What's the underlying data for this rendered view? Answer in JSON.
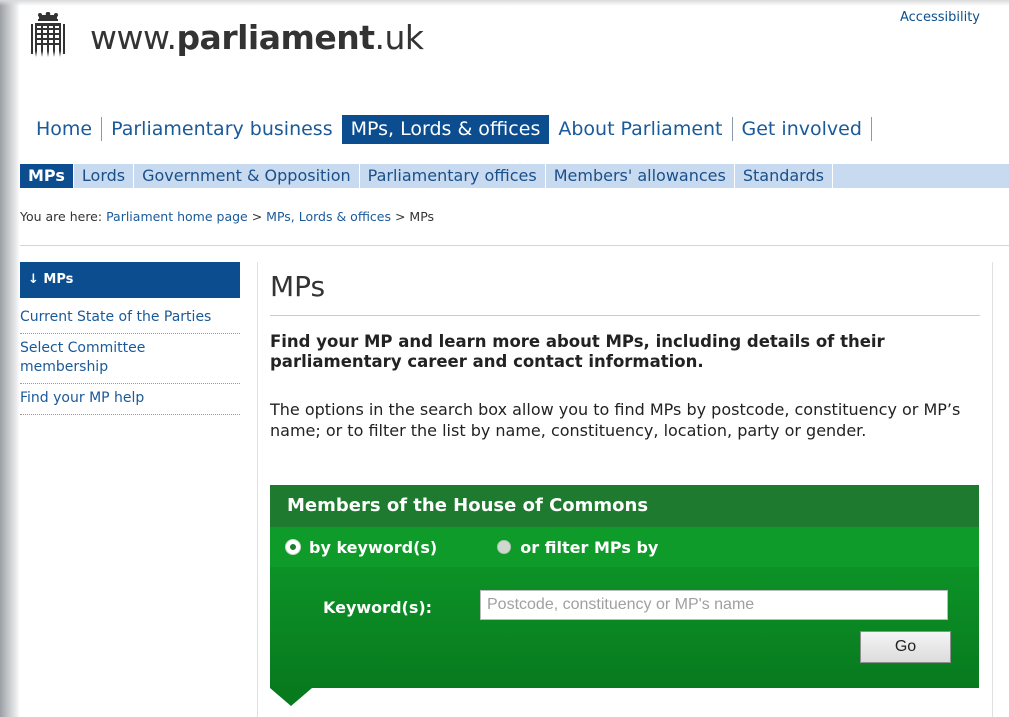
{
  "header": {
    "site_name_prefix": "www.",
    "site_name_bold": "parliament",
    "site_name_suffix": ".uk",
    "accessibility_label": "Accessibility"
  },
  "main_nav": {
    "items": [
      {
        "label": "Home"
      },
      {
        "label": "Parliamentary business"
      },
      {
        "label": "MPs, Lords & offices",
        "active": true
      },
      {
        "label": "About Parliament"
      },
      {
        "label": "Get involved"
      }
    ]
  },
  "sub_nav": {
    "items": [
      {
        "label": "MPs",
        "active": true
      },
      {
        "label": "Lords"
      },
      {
        "label": "Government & Opposition"
      },
      {
        "label": "Parliamentary offices"
      },
      {
        "label": "Members' allowances"
      },
      {
        "label": "Standards"
      }
    ]
  },
  "breadcrumb": {
    "prefix": "You are here: ",
    "items": [
      "Parliament home page",
      "MPs, Lords & offices"
    ],
    "separator": " > ",
    "current": "MPs"
  },
  "sidebar": {
    "heading": "↓ MPs",
    "items": [
      {
        "label": "Current State of the Parties"
      },
      {
        "label": "Select Committee membership"
      },
      {
        "label": "Find your MP help"
      }
    ]
  },
  "main": {
    "title": "MPs",
    "lead": "Find your MP and learn more about MPs, including details of their parliamentary career and contact information.",
    "intro": "The options in the search box allow you to find MPs by postcode, constituency or MP’s name; or to filter the list by name, constituency, location, party or gender."
  },
  "search": {
    "heading": "Members of the House of Commons",
    "option_keyword": "by keyword(s)",
    "option_filter": "or filter MPs by",
    "selected_option": "by keyword(s)",
    "keyword_label": "Keyword(s):",
    "keyword_value": "",
    "keyword_placeholder": "Postcode, constituency or MP's name",
    "go_label": "Go"
  },
  "colors": {
    "nav_active": "#0b4d8f",
    "subnav_bg": "#c8daf0",
    "link": "#1a5a99",
    "search_header": "#1e7a2e",
    "search_green": "#0f9b2a"
  }
}
